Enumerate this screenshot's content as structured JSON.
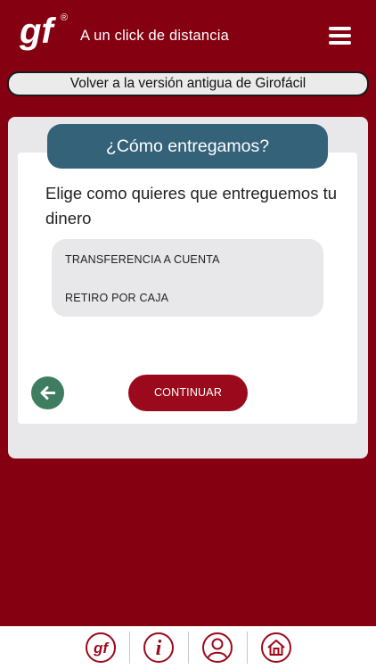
{
  "header": {
    "logo_text": "gf",
    "logo_registered": "®",
    "tagline": "A un click de distancia",
    "menu_icon": "hamburger-icon"
  },
  "legacy_link": {
    "label": "Volver a la versión antigua de Girofácil"
  },
  "delivery": {
    "title": "¿Cómo entregamos?",
    "question": "Elige como quieres que entreguemos tu dinero",
    "options": [
      {
        "label": "TRANSFERENCIA A CUENTA"
      },
      {
        "label": "RETIRO POR CAJA"
      }
    ],
    "back_icon": "arrow-left-icon",
    "continue_label": "CONTINUAR"
  },
  "bottom_nav": {
    "items": [
      {
        "icon": "gf-logo-icon",
        "text": "gf"
      },
      {
        "icon": "info-icon",
        "text": "i"
      },
      {
        "icon": "user-icon"
      },
      {
        "icon": "home-icon"
      }
    ]
  },
  "colors": {
    "brand_red": "#850010",
    "button_red": "#9b0a1c",
    "title_teal": "#346279",
    "back_green": "#3f7d60",
    "card_gray": "#e8e8ea"
  }
}
